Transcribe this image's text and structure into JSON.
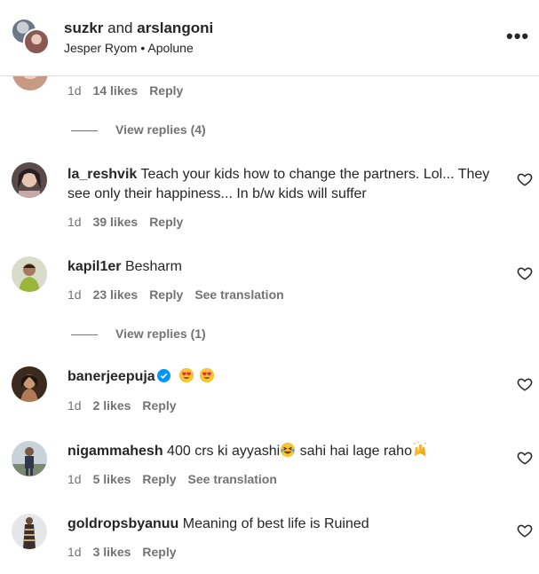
{
  "header": {
    "user1": "suzkr",
    "conj": " and ",
    "user2": "arslangoni",
    "subtitle": "Jesper Ryom • Apolune",
    "more_icon": "more-horizontal-icon"
  },
  "top_comment": {
    "time": "1d",
    "likes": "14 likes",
    "reply": "Reply",
    "view_replies": "View replies (4)"
  },
  "comments": [
    {
      "username": "la_reshvik",
      "text": "Teach your kids how to change the partners. Lol... They see only their happiness... In b/w kids will suffer",
      "time": "1d",
      "likes": "39 likes",
      "reply": "Reply"
    },
    {
      "username": "kapil1er",
      "text": "Besharm",
      "time": "1d",
      "likes": "23 likes",
      "reply": "Reply",
      "translate": "See translation",
      "view_replies": "View replies (1)"
    },
    {
      "username": "banerjeepuja",
      "verified": true,
      "text": "",
      "emojis": [
        "heart-eyes-emoji",
        "heart-eyes-emoji"
      ],
      "time": "1d",
      "likes": "2 likes",
      "reply": "Reply"
    },
    {
      "username": "nigammahesh",
      "text_a": "400 crs ki ayyashi",
      "text_b": " sahi hai lage raho",
      "time": "1d",
      "likes": "5 likes",
      "reply": "Reply",
      "translate": "See translation"
    },
    {
      "username": "goldropsbyanuu",
      "text": "Meaning of best life is Ruined",
      "time": "1d",
      "likes": "3 likes",
      "reply": "Reply"
    }
  ],
  "colors": {
    "text": "#262626",
    "secondary": "#737373",
    "verified": "#0095f6",
    "divider": "#dbdbdb"
  }
}
